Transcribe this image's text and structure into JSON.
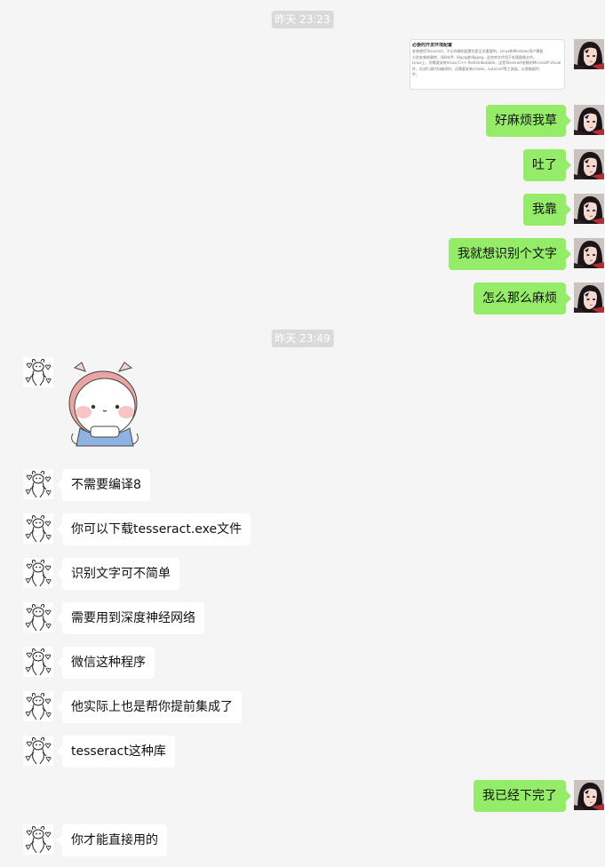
{
  "timestamps": [
    "昨天 23:23",
    "昨天 23:49"
  ],
  "screenshot_preview": {
    "title": "必要的开发环境配置",
    "lines": [
      "安装使用Tesseract，不论你确的配置也是至关重要的，Linux和Windows用户需要",
      "分别安装依赖库，如libtiff，libpng和libjpeg，这些库文件用于处理图像文件。",
      "Linux上，你需要安装Visual C++ Redistributable，这是Tesseract依赖的Microsoft Visual",
      "件。在进行源代码编译时，还需要安装cmake，autoconf等工具链，以便能顺利",
      "件。"
    ]
  },
  "messages": [
    {
      "side": "mine",
      "text": "好麻烦我草"
    },
    {
      "side": "mine",
      "text": "吐了"
    },
    {
      "side": "mine",
      "text": "我靠"
    },
    {
      "side": "mine",
      "text": "我就想识别个文字"
    },
    {
      "side": "mine",
      "text": "怎么那么麻烦"
    },
    {
      "side": "theirs",
      "text": "不需要编译8"
    },
    {
      "side": "theirs",
      "text": "你可以下载tesseract.exe文件"
    },
    {
      "side": "theirs",
      "text": "识别文字可不简单"
    },
    {
      "side": "theirs",
      "text": "需要用到深度神经网络"
    },
    {
      "side": "theirs",
      "text": "微信这种程序"
    },
    {
      "side": "theirs",
      "text": "他实际上也是帮你提前集成了"
    },
    {
      "side": "theirs",
      "text": "tesseract这种库"
    },
    {
      "side": "mine",
      "text": "我已经下完了"
    },
    {
      "side": "theirs",
      "text": "你才能直接用的"
    }
  ],
  "colors": {
    "background": "#f5f5f5",
    "mine_bubble": "#95ec69",
    "theirs_bubble": "#ffffff",
    "timestamp_bg": "#dadada"
  },
  "icons": {
    "my_avatar": "dark-haired-girl-avatar-icon",
    "their_avatar": "bunny-doodle-avatar-icon",
    "sticker": "cute-cat-sticker"
  }
}
